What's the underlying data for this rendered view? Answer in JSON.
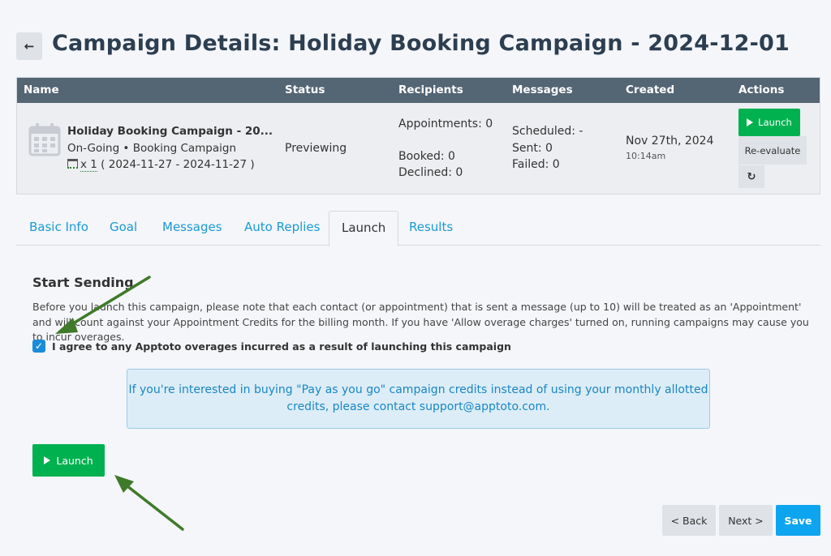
{
  "header": {
    "back_icon": "arrow-left-icon",
    "title": "Campaign Details: Holiday Booking Campaign - 2024-12-01"
  },
  "table": {
    "columns": {
      "name": "Name",
      "status": "Status",
      "recipients": "Recipients",
      "messages": "Messages",
      "created": "Created",
      "actions": "Actions"
    },
    "row": {
      "icon": "calendar-icon",
      "name": "Holiday Booking Campaign - 20...",
      "type": "On-Going • Booking Campaign",
      "dates_count": "x 1",
      "dates_range": "( 2024-11-27 - 2024-11-27 )",
      "status": "Previewing",
      "appointments": "Appointments: 0",
      "booked": "Booked: 0",
      "declined": "Declined: 0",
      "scheduled": "Scheduled: -",
      "sent": "Sent: 0",
      "failed": "Failed: 0",
      "created_date": "Nov 27th, 2024",
      "created_time": "10:14am",
      "launch_label": "Launch",
      "reevaluate_label": "Re-evaluate",
      "refresh_icon": "refresh-icon"
    }
  },
  "tabs": [
    {
      "label": "Basic Info"
    },
    {
      "label": "Goal"
    },
    {
      "label": "Messages"
    },
    {
      "label": "Auto Replies"
    },
    {
      "label": "Launch",
      "active": true
    },
    {
      "label": "Results"
    }
  ],
  "launch": {
    "section_title": "Start Sending",
    "note": "Before you launch this campaign, please note that each contact (or appointment) that is sent a message (up to 10) will be treated as an 'Appointment' and will count against your Appointment Credits for the billing month. If you have 'Allow overage charges' turned on, running campaigns may cause you to incur overages.",
    "agree_label": "I agree to any Apptoto overages incurred as a result of launching this campaign",
    "agree_checked": true,
    "info": "If you're interested in buying \"Pay as you go\" campaign credits instead of using your monthly allotted credits, please contact support@apptoto.com.",
    "launch_label": "Launch"
  },
  "footer": {
    "back_label": "< Back",
    "next_label": "Next >",
    "save_label": "Save"
  },
  "colors": {
    "header_bg": "#546574",
    "launch_green": "#00b14f",
    "link_blue": "#1a9ad6",
    "save_blue": "#0ea5f0",
    "annotation_arrow": "#3f7a2a"
  }
}
